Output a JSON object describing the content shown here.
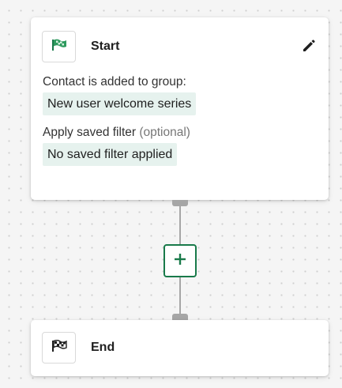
{
  "start_node": {
    "title": "Start",
    "icon": "flag-icon",
    "trigger_label": "Contact is added to group:",
    "trigger_value": "New user welcome series",
    "filter_label": "Apply saved filter",
    "filter_optional": "(optional)",
    "filter_value": "No saved filter applied"
  },
  "add_step": {
    "icon": "plus-icon"
  },
  "end_node": {
    "title": "End",
    "icon": "checkered-flag-icon"
  },
  "colors": {
    "accent": "#197a4a",
    "chip_background": "#e6f2ee",
    "connector": "#a6a6a6"
  }
}
